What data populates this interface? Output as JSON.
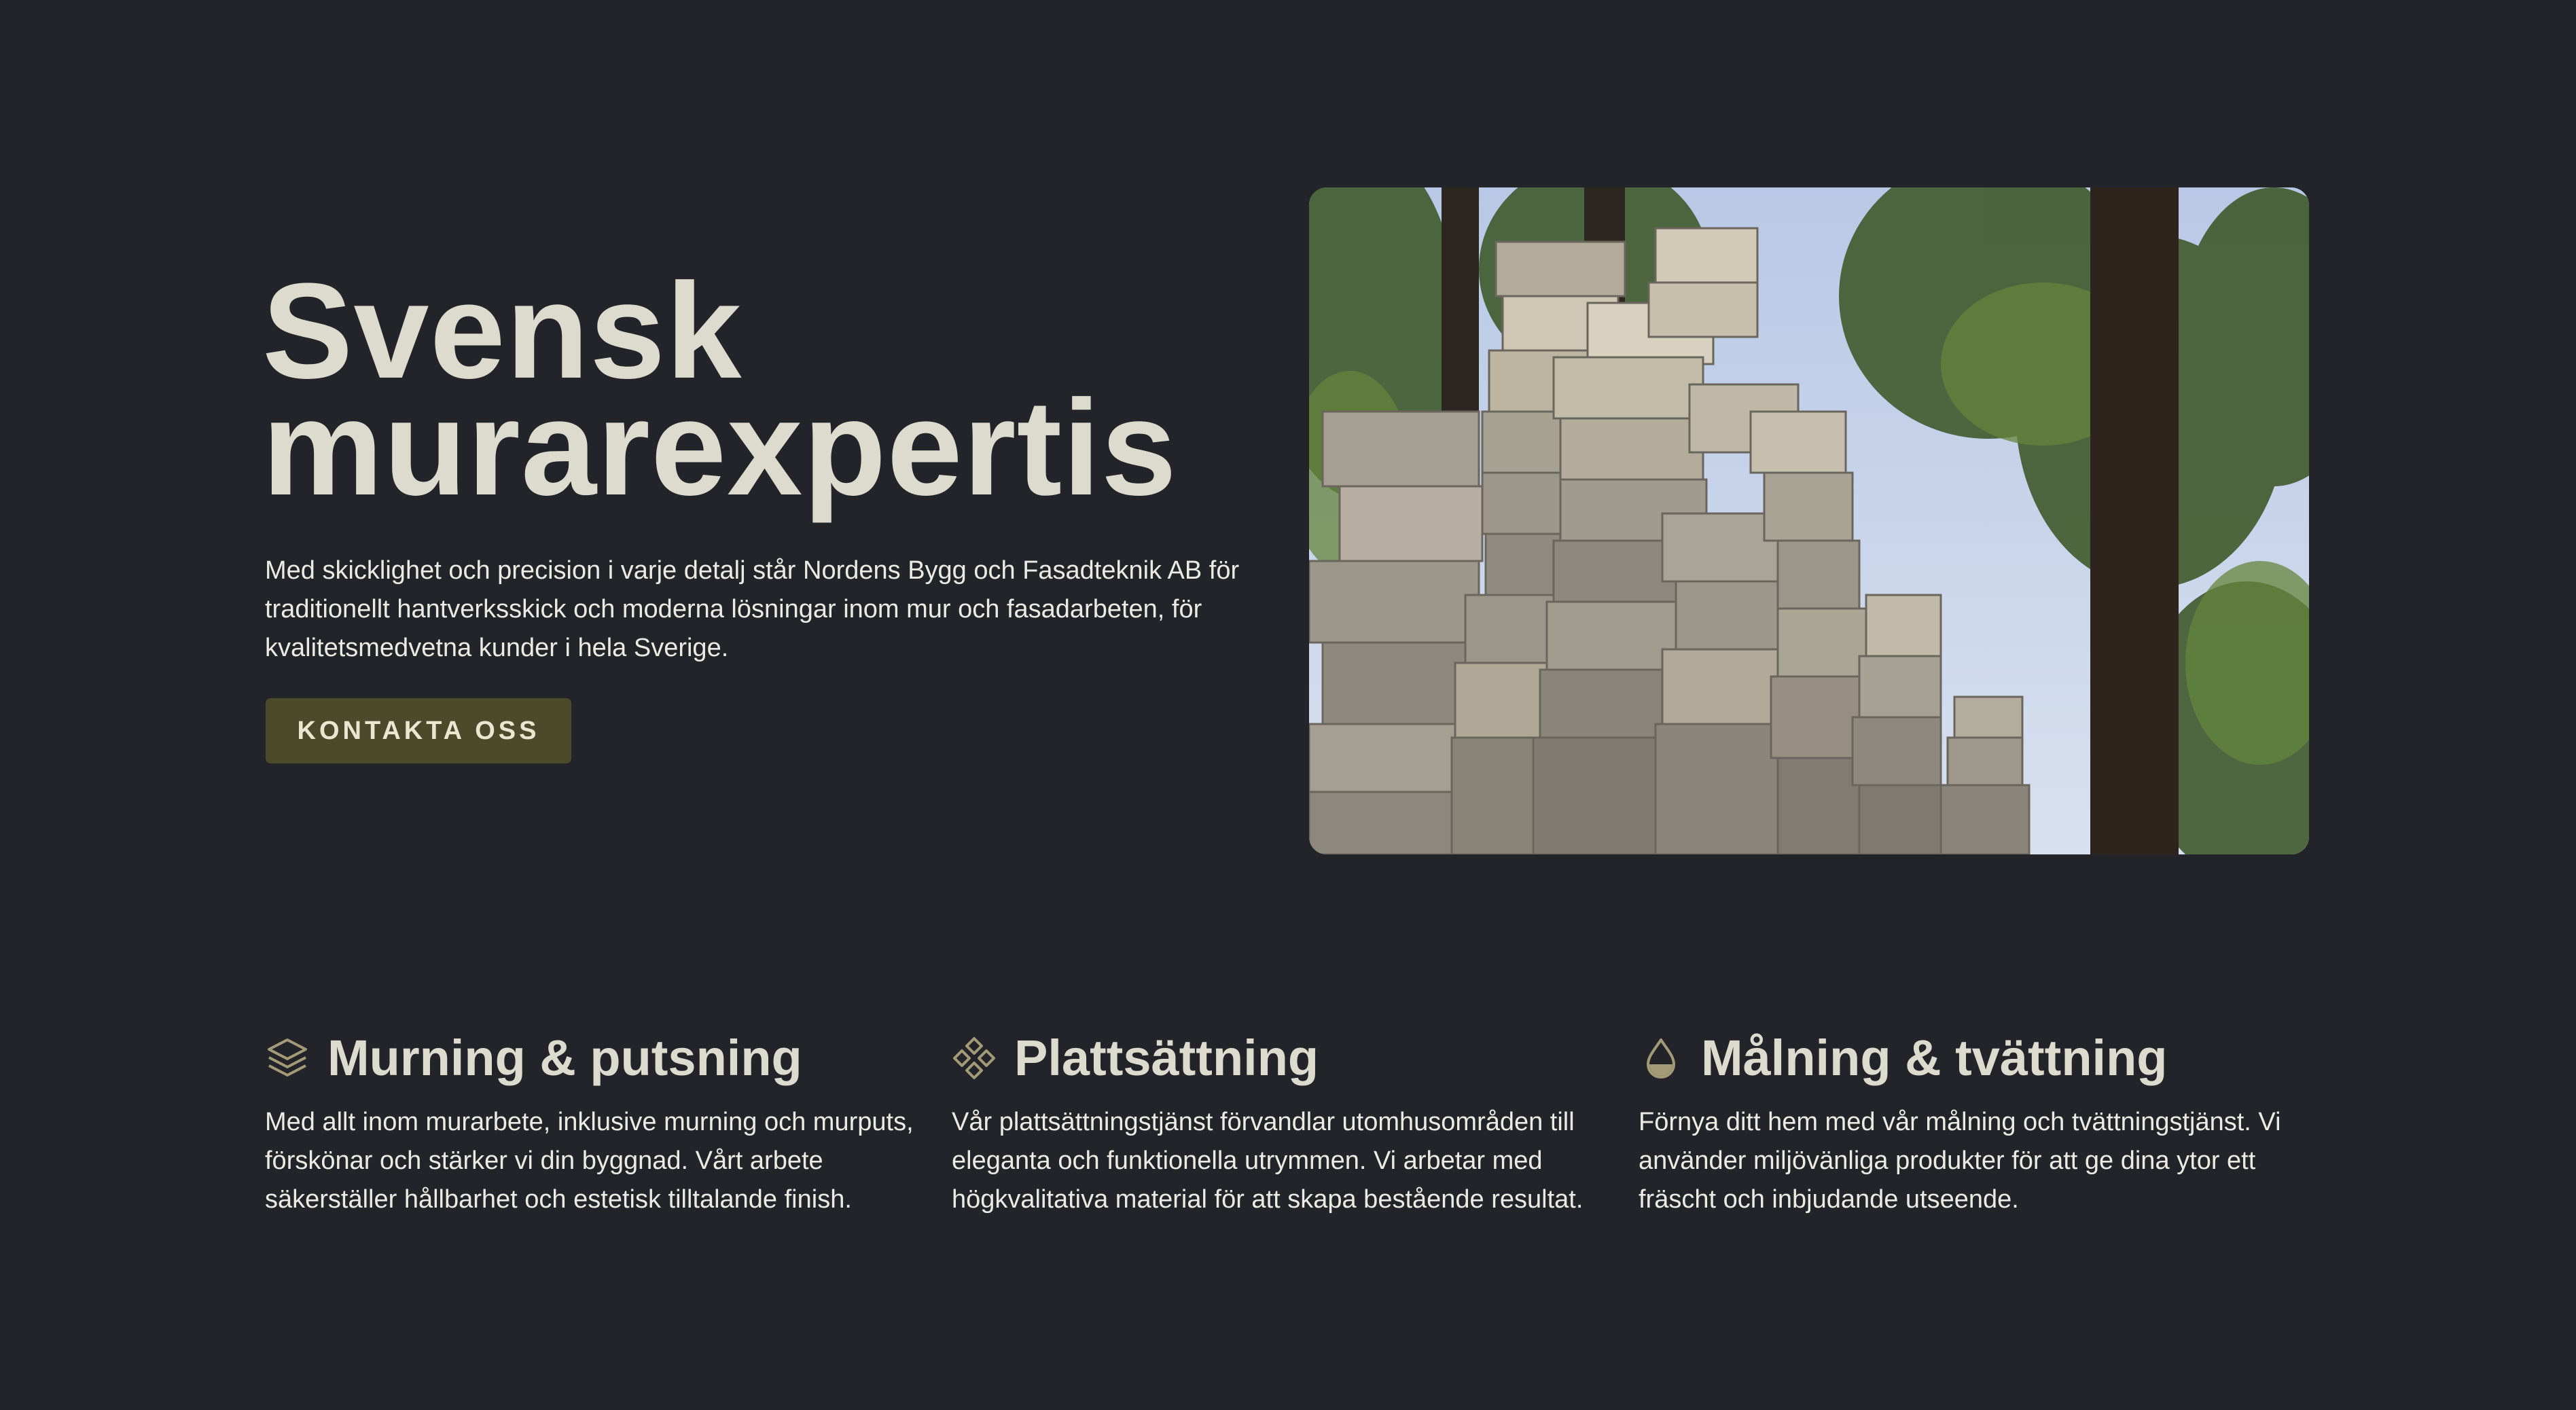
{
  "hero": {
    "title_line1": "Svensk",
    "title_line2": "murarexpertis",
    "description": "Med skicklighet och precision i varje detalj står Nordens Bygg och Fasadteknik AB för traditionellt hantverksskick och moderna lösningar inom mur och fasadarbeten, för kvalitetsmedvetna kunder i hela Sverige.",
    "button_label": "KONTAKTA OSS",
    "image_icon": "stacked-bricks-photo"
  },
  "services": [
    {
      "icon": "layers-icon",
      "title": "Murning & putsning",
      "text": "Med allt inom murarbete, inklusive murning och murputs, förskönar och stärker vi din byggnad. Vårt arbete säkerställer hållbarhet och estetisk tilltalande finish."
    },
    {
      "icon": "tiles-diamond-icon",
      "title": "Plattsättning",
      "text": "Vår plattsättningstjänst förvandlar utomhusområden till eleganta och funktionella utrymmen. Vi arbetar med högkvalitativa material för att skapa bestående resultat."
    },
    {
      "icon": "droplet-icon",
      "title": "Målning & tvättning",
      "text": "Förnya ditt hem med vår målning och tvättningstjänst. Vi använder miljövänliga produkter för att ge dina ytor ett fräscht och inbjudande utseende."
    }
  ],
  "colors": {
    "background": "#232429",
    "heading": "#dcdbcd",
    "body_text": "#ecebe3",
    "button_bg": "#4b4a2b",
    "icon_accent": "#a39a78"
  }
}
